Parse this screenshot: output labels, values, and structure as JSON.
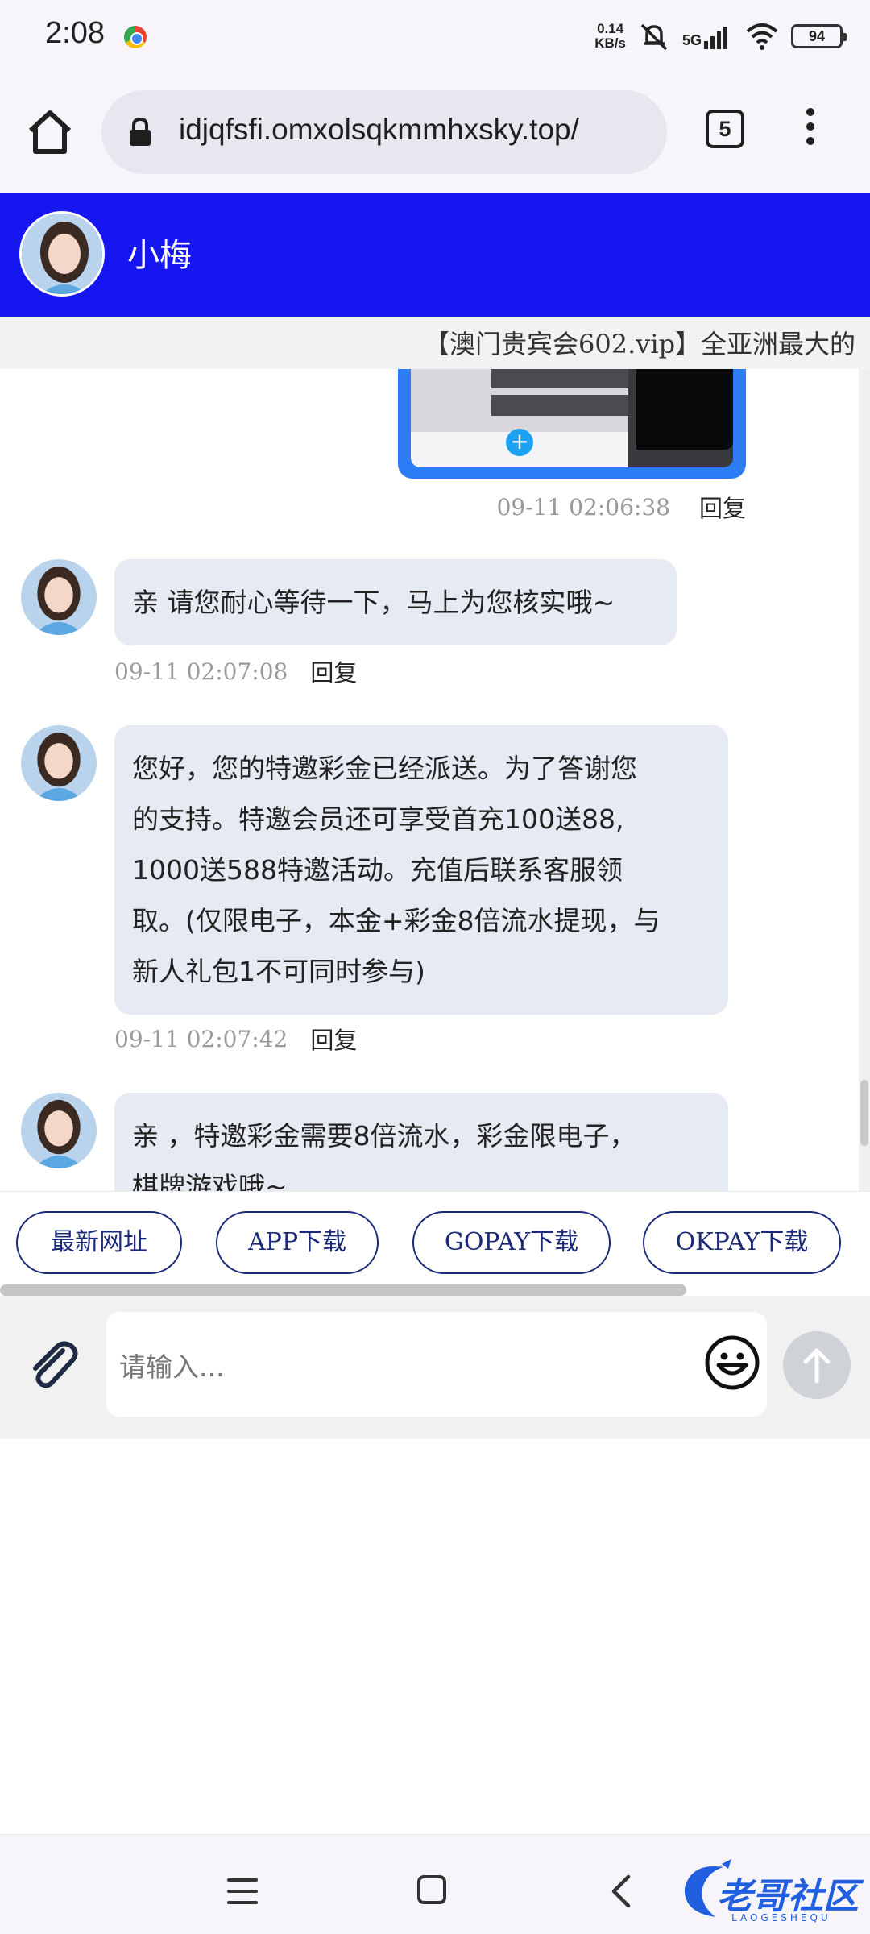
{
  "status_bar": {
    "time": "2:08",
    "net_speed_value": "0.14",
    "net_speed_unit": "KB/s",
    "network": "5G",
    "battery": "94"
  },
  "browser": {
    "url": "idjqfsfi.omxolsqkmmhxsky.top/",
    "tab_count": "5"
  },
  "chat": {
    "contact_name": "小梅",
    "marquee": "【澳门贵宾会602.vip】全亚洲最大的"
  },
  "messages": {
    "sent_image_meta": {
      "time": "09-11 02:06:38",
      "reply": "回复"
    },
    "items": [
      {
        "text": "亲 请您耐心等待一下，马上为您核实哦~",
        "time": "09-11 02:07:08",
        "reply": "回复"
      },
      {
        "lines": [
          "您好，您的特邀彩金已经派送。为了答谢您",
          "的支持。特邀会员还可享受首充100送88,",
          "1000送588特邀活动。充值后联系客服领",
          "取。(仅限电子，本金+彩金8倍流水提现，与",
          "新人礼包1不可同时参与)"
        ],
        "time": "09-11 02:07:42",
        "reply": "回复"
      },
      {
        "lines": [
          "亲 ，特邀彩金需要8倍流水，彩金限电子，",
          "棋牌游戏哦~"
        ]
      }
    ]
  },
  "quick_buttons": [
    "最新网址",
    "APP下载",
    "GOPAY下载",
    "OKPAY下载"
  ],
  "input": {
    "placeholder": "请输入..."
  },
  "watermark": {
    "text": "老哥社区",
    "sub": "LAOGESHEQU"
  },
  "colors": {
    "header_bg": "#1616f0",
    "bubble_bg": "#e6eaf2",
    "sent_bubble": "#2c7cf6",
    "quick_btn": "#1c2a7a"
  }
}
